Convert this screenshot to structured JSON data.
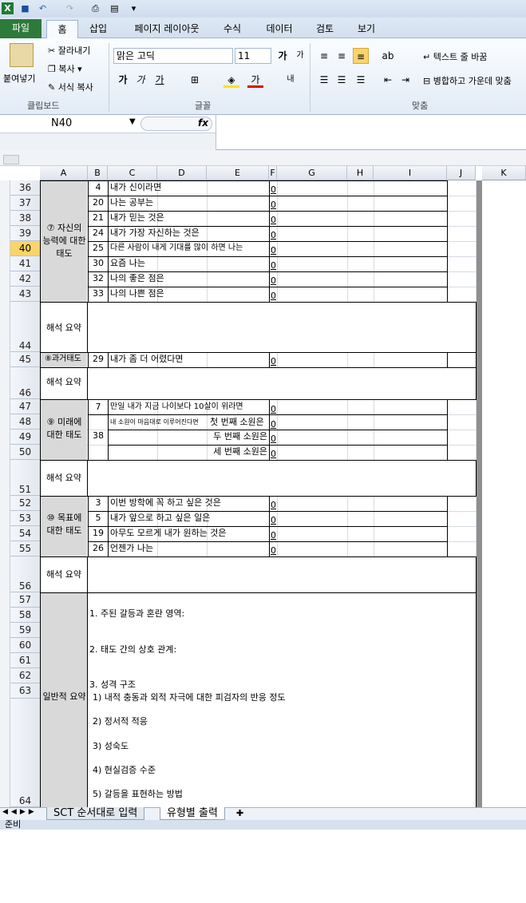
{
  "app": {
    "name_cell": "N40",
    "fx": "fx"
  },
  "tabs": [
    "파일",
    "홈",
    "삽입",
    "페이지 레이아웃",
    "수식",
    "데이터",
    "검토",
    "보기"
  ],
  "ribbon": {
    "paste": "붙여넣기",
    "cut": "잘라내기",
    "copy": "복사",
    "format_painter": "서식 복사",
    "clipboard": "클립보드",
    "font_name": "맑은 고딕",
    "font_size": "11",
    "font_group": "글꼴",
    "wrap": "텍스트 줄 바꿈",
    "merge": "병합하고 가운데 맞춤",
    "align_group": "맞춤"
  },
  "columns": [
    "A",
    "B",
    "C",
    "D",
    "E",
    "F",
    "G",
    "H",
    "I",
    "J",
    "K"
  ],
  "rows": [
    {
      "n": "36",
      "a": "",
      "b": "4",
      "c": "내가 신이라면",
      "g": "0"
    },
    {
      "n": "37",
      "a": "",
      "b": "20",
      "c": "나는 공부는",
      "g": "0"
    },
    {
      "n": "38",
      "a": "",
      "b": "21",
      "c": "내가 믿는 것은",
      "g": "0"
    },
    {
      "n": "39",
      "a": "",
      "b": "24",
      "c": "내가 가장 자신하는 것은",
      "g": "0"
    },
    {
      "n": "40",
      "a": "",
      "b": "25",
      "c": "다른 사람이 내게 기대를 많이 하면 나는",
      "g": "0"
    },
    {
      "n": "41",
      "a": "",
      "b": "30",
      "c": "요즘 나는",
      "g": "0"
    },
    {
      "n": "42",
      "a": "",
      "b": "32",
      "c": "나의 좋은 점은",
      "g": "0"
    },
    {
      "n": "43",
      "a": "",
      "b": "33",
      "c": "나의 나쁜 점은",
      "g": "0"
    }
  ],
  "labels": {
    "self_attitude": "⑦ 자신의 능력에 대한 태도",
    "summary": "해석 요약",
    "past": "⑧과거태도",
    "future": "⑨ 미래에 대한 태도",
    "goal": "⑩ 목표에 대한 태도",
    "general": "일반적 요약"
  },
  "past_row": {
    "b": "29",
    "c": "내가 좀 더 어렸다면",
    "g": "0"
  },
  "future_rows": [
    {
      "b": "7",
      "c": "만일 내가 지금 나이보다 10살이 위라면",
      "g": "0"
    },
    {
      "b": "38",
      "c_small": "내 소원이 마음대로 이루어진다면",
      "c": "첫 번째 소원은",
      "g": "0"
    },
    {
      "c": "두 번째 소원은",
      "g": "0"
    },
    {
      "c": "세 번째 소원은",
      "g": "0"
    }
  ],
  "goal_rows": [
    {
      "b": "3",
      "c": "이번 방학에 꼭 하고 싶은 것은",
      "g": "0"
    },
    {
      "b": "5",
      "c": "내가 앞으로 하고 싶은 일은",
      "g": "0"
    },
    {
      "b": "19",
      "c": "아무도 모르게 내가 원하는 것은",
      "g": "0"
    },
    {
      "b": "26",
      "c": "언젠가 나는",
      "g": "0"
    }
  ],
  "row_numbers": {
    "r44": "44",
    "r45": "45",
    "r46": "46",
    "r47": "47",
    "r48": "48",
    "r49": "49",
    "r50": "50",
    "r51": "51",
    "r52": "52",
    "r53": "53",
    "r54": "54",
    "r55": "55",
    "r56": "56",
    "r57": "57",
    "r58": "58",
    "r59": "59",
    "r60": "60",
    "r61": "61",
    "r62": "62",
    "r63": "63",
    "r64": "64"
  },
  "general": {
    "l1": "1. 주된 갈등과 혼란 영역:",
    "l2": "2. 태도 간의 상호 관계:",
    "l3": "3. 성격 구조",
    "l3a": "1) 내적 충동과 외적 자극에 대한 피검자의 반응 정도",
    "l3b": "2) 정서적 적응",
    "l3c": "3) 성숙도",
    "l3d": "4) 현실검증 수준",
    "l3e": "5) 갈등을 표현하는 방법"
  },
  "sheets": [
    "SCT 순서대로 입력",
    "유형별 출력"
  ],
  "status": "준비"
}
